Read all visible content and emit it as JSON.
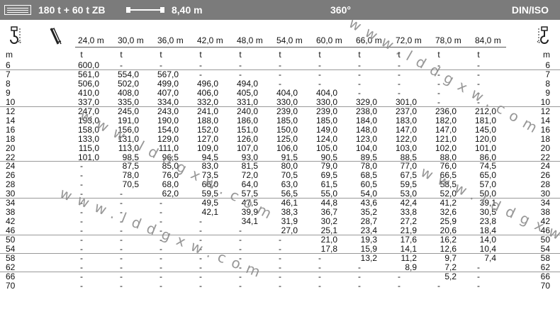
{
  "header": {
    "config": "180 t + 60 t ZB",
    "boom_length": "8,40 m",
    "slew": "360°",
    "norm": "DIN/ISO",
    "icons": [
      "menu-icon",
      "boom-icon",
      "hook-icon",
      "jib-icon"
    ]
  },
  "columns": {
    "radius_label": "m",
    "unit": "t",
    "boom_labels": [
      "24,0 m",
      "30,0 m",
      "36,0 m",
      "42,0 m",
      "48,0 m",
      "54,0 m",
      "60,0 m",
      "66,0 m",
      "72,0 m",
      "78,0 m",
      "84,0 m"
    ]
  },
  "rows": [
    {
      "r": "6",
      "v": [
        "600,0",
        "-",
        "-",
        "-",
        "-",
        "-",
        "-",
        "-",
        "-",
        "-",
        "-"
      ]
    },
    {
      "r": "7",
      "v": [
        "561,0",
        "554,0",
        "567,0",
        "-",
        "-",
        "-",
        "-",
        "-",
        "-",
        "-",
        "-"
      ]
    },
    {
      "r": "8",
      "v": [
        "506,0",
        "502,0",
        "499,0",
        "496,0",
        "494,0",
        "-",
        "-",
        "-",
        "-",
        "-",
        "-"
      ]
    },
    {
      "r": "9",
      "v": [
        "410,0",
        "408,0",
        "407,0",
        "406,0",
        "405,0",
        "404,0",
        "404,0",
        "-",
        "-",
        "-",
        "-"
      ]
    },
    {
      "r": "10",
      "v": [
        "337,0",
        "335,0",
        "334,0",
        "332,0",
        "331,0",
        "330,0",
        "330,0",
        "329,0",
        "301,0",
        "-",
        "-"
      ]
    },
    {
      "r": "12",
      "v": [
        "247,0",
        "245,0",
        "243,0",
        "241,0",
        "240,0",
        "239,0",
        "239,0",
        "238,0",
        "237,0",
        "236,0",
        "212,0"
      ]
    },
    {
      "r": "14",
      "v": [
        "193,0",
        "191,0",
        "190,0",
        "188,0",
        "186,0",
        "185,0",
        "185,0",
        "184,0",
        "183,0",
        "182,0",
        "181,0"
      ]
    },
    {
      "r": "16",
      "v": [
        "158,0",
        "156,0",
        "154,0",
        "152,0",
        "151,0",
        "150,0",
        "149,0",
        "148,0",
        "147,0",
        "147,0",
        "145,0"
      ]
    },
    {
      "r": "18",
      "v": [
        "133,0",
        "131,0",
        "129,0",
        "127,0",
        "126,0",
        "125,0",
        "124,0",
        "123,0",
        "122,0",
        "121,0",
        "120,0"
      ]
    },
    {
      "r": "20",
      "v": [
        "115,0",
        "113,0",
        "111,0",
        "109,0",
        "107,0",
        "106,0",
        "105,0",
        "104,0",
        "103,0",
        "102,0",
        "101,0"
      ]
    },
    {
      "r": "22",
      "v": [
        "101,0",
        "98,5",
        "96,5",
        "94,5",
        "93,0",
        "91,5",
        "90,5",
        "89,5",
        "88,5",
        "88,0",
        "86,0"
      ]
    },
    {
      "r": "24",
      "v": [
        "-",
        "87,5",
        "85,0",
        "83,0",
        "81,5",
        "80,0",
        "79,0",
        "78,0",
        "77,0",
        "76,0",
        "74,5"
      ]
    },
    {
      "r": "26",
      "v": [
        "-",
        "78,0",
        "76,0",
        "73,5",
        "72,0",
        "70,5",
        "69,5",
        "68,5",
        "67,5",
        "66,5",
        "65,0"
      ]
    },
    {
      "r": "28",
      "v": [
        "-",
        "70,5",
        "68,0",
        "66,0",
        "64,0",
        "63,0",
        "61,5",
        "60,5",
        "59,5",
        "58,5",
        "57,0"
      ]
    },
    {
      "r": "30",
      "v": [
        "-",
        "-",
        "62,0",
        "59,5",
        "57,5",
        "56,5",
        "55,0",
        "54,0",
        "53,0",
        "52,0",
        "50,0"
      ]
    },
    {
      "r": "34",
      "v": [
        "-",
        "-",
        "-",
        "49,5",
        "47,5",
        "46,1",
        "44,8",
        "43,6",
        "42,4",
        "41,2",
        "39,1"
      ]
    },
    {
      "r": "38",
      "v": [
        "-",
        "-",
        "-",
        "42,1",
        "39,9",
        "38,3",
        "36,7",
        "35,2",
        "33,8",
        "32,6",
        "30,5"
      ]
    },
    {
      "r": "42",
      "v": [
        "-",
        "-",
        "-",
        "-",
        "34,1",
        "31,9",
        "30,2",
        "28,7",
        "27,2",
        "25,9",
        "23,8"
      ]
    },
    {
      "r": "46",
      "v": [
        "-",
        "-",
        "-",
        "-",
        "-",
        "27,0",
        "25,1",
        "23,4",
        "21,9",
        "20,6",
        "18,4"
      ]
    },
    {
      "r": "50",
      "v": [
        "-",
        "-",
        "-",
        "-",
        "-",
        "-",
        "21,0",
        "19,3",
        "17,6",
        "16,2",
        "14,0"
      ]
    },
    {
      "r": "54",
      "v": [
        "-",
        "-",
        "-",
        "-",
        "-",
        "-",
        "17,8",
        "15,9",
        "14,1",
        "12,6",
        "10,4"
      ]
    },
    {
      "r": "58",
      "v": [
        "-",
        "-",
        "-",
        "-",
        "-",
        "-",
        "-",
        "13,2",
        "11,2",
        "9,7",
        "7,4"
      ]
    },
    {
      "r": "62",
      "v": [
        "-",
        "-",
        "-",
        "-",
        "-",
        "-",
        "-",
        "-",
        "8,9",
        "7,2",
        "-"
      ]
    },
    {
      "r": "66",
      "v": [
        "-",
        "-",
        "-",
        "-",
        "-",
        "-",
        "-",
        "-",
        "-",
        "5,2",
        "-"
      ]
    },
    {
      "r": "70",
      "v": [
        "-",
        "-",
        "-",
        "-",
        "-",
        "-",
        "-",
        "-",
        "-",
        "-",
        "-"
      ]
    }
  ],
  "watermark": "www.lddgxw.com"
}
